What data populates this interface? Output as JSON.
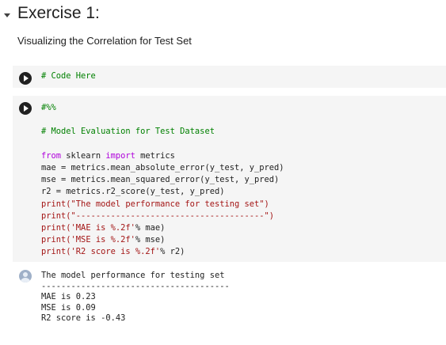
{
  "section": {
    "title": "Exercise 1:",
    "description": "Visualizing the Correlation for Test Set"
  },
  "cell1": {
    "comment": "# Code Here"
  },
  "cell2": {
    "l1": "#%%",
    "l2": "# Model Evaluation for Test Dataset",
    "l3_kw1": "from",
    "l3_mid": " sklearn ",
    "l3_kw2": "import",
    "l3_end": " metrics",
    "l4": "mae = metrics.mean_absolute_error(y_test, y_pred)",
    "l5": "mse = metrics.mean_squared_error(y_test, y_pred)",
    "l6": "r2 = metrics.r2_score(y_test, y_pred)",
    "l7_fn": "print(",
    "l7_str": "\"The model performance for testing set\"",
    "l7_end": ")",
    "l8_fn": "print(",
    "l8_str": "\"--------------------------------------\"",
    "l8_end": ")",
    "l9_fn": "print(",
    "l9_str": "'MAE is %.2f'",
    "l9_end": "% mae)",
    "l10_fn": "print(",
    "l10_str": "'MSE is %.2f'",
    "l10_end": "% mse)",
    "l11_fn": "print(",
    "l11_str": "'R2 score is %.2f'",
    "l11_end": "% r2)"
  },
  "output": {
    "l1": "The model performance for testing set",
    "l2": "--------------------------------------",
    "l3": "MAE is 0.23",
    "l4": "MSE is 0.09",
    "l5": "R2 score is -0.43"
  },
  "icons": {
    "caret": "chevron-down-icon",
    "run": "play-icon",
    "output": "avatar-icon"
  },
  "colors": {
    "cell_bg": "#f5f5f5",
    "comment": "#008000",
    "keyword": "#af00db",
    "string": "#a31515"
  }
}
